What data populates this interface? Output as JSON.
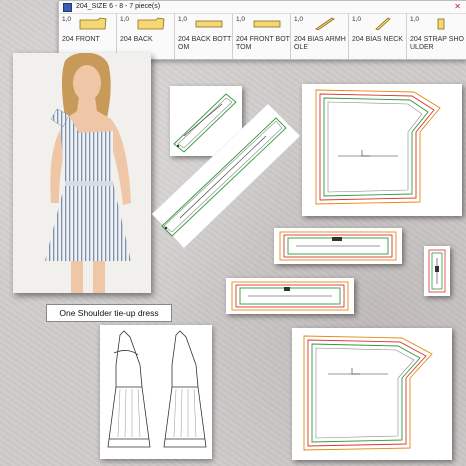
{
  "window": {
    "title": "204_SIZE 6 - 8  -  7 piece(s)",
    "pieces": [
      {
        "qty": "1,0",
        "name": "204 FRONT"
      },
      {
        "qty": "1,0",
        "name": "204 BACK"
      },
      {
        "qty": "1,0",
        "name": "204 BACK BOTT OM"
      },
      {
        "qty": "1,0",
        "name": "204 FRONT BOT TOM"
      },
      {
        "qty": "1,0",
        "name": "204 BIAS ARMH OLE"
      },
      {
        "qty": "1,0",
        "name": "204 BIAS NECK"
      },
      {
        "qty": "1,0",
        "name": "204 STRAP SHO ULDER"
      }
    ]
  },
  "caption": "One Shoulder tie-up dress",
  "colors": {
    "piece_fill": "#f5d774",
    "piece_stroke": "#8a6b1c",
    "seam_green": "#2f9a3a",
    "seam_red": "#d33",
    "seam_orange": "#e38a12",
    "seam_gray": "#888"
  }
}
